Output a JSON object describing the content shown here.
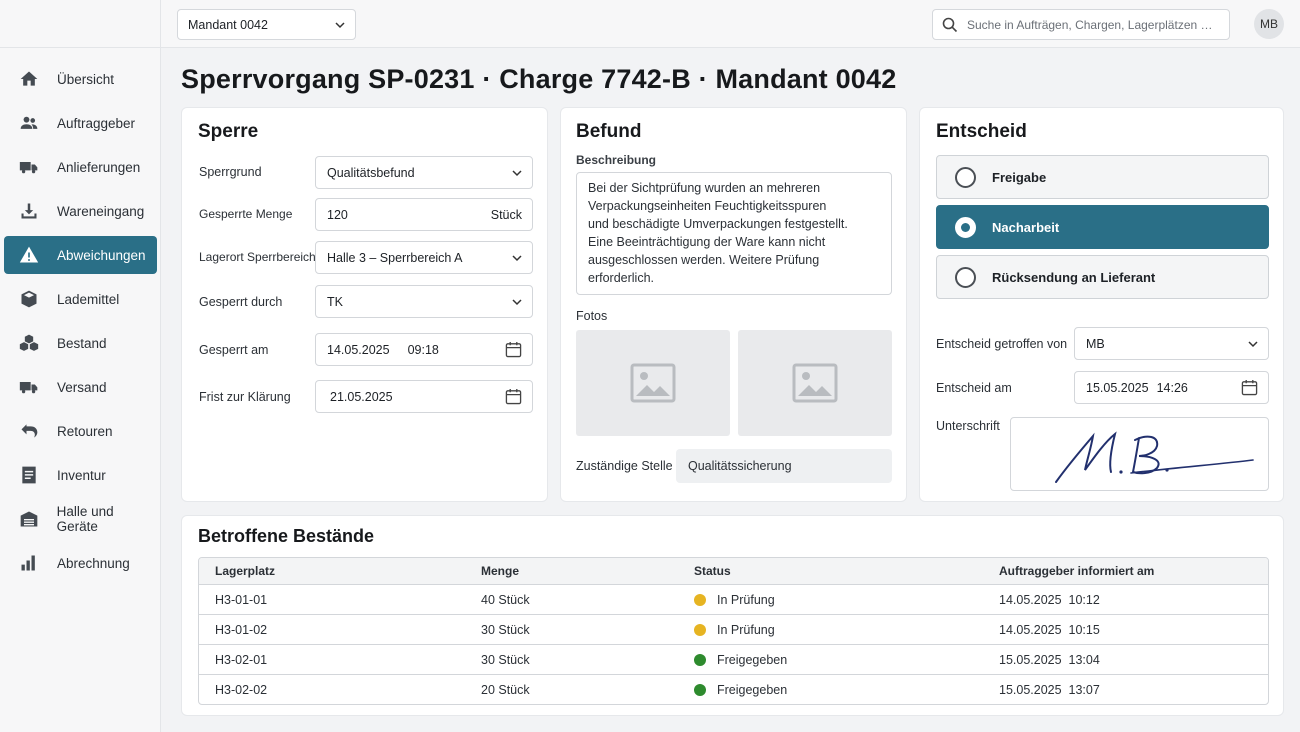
{
  "topbar": {
    "mandant_label": "Mandant 0042",
    "search_placeholder": "Suche in Aufträgen, Chargen, Lagerplätzen …",
    "avatar": "MB"
  },
  "sidebar": {
    "items": [
      {
        "label": "Übersicht",
        "icon": "home-icon"
      },
      {
        "label": "Auftraggeber",
        "icon": "users-icon"
      },
      {
        "label": "Anlieferungen",
        "icon": "truck-icon"
      },
      {
        "label": "Wareneingang",
        "icon": "download-icon"
      },
      {
        "label": "Abweichungen",
        "icon": "warning-icon"
      },
      {
        "label": "Lademittel",
        "icon": "box-icon"
      },
      {
        "label": "Bestand",
        "icon": "boxes-icon"
      },
      {
        "label": "Versand",
        "icon": "truck-icon"
      },
      {
        "label": "Retouren",
        "icon": "return-arrow-icon"
      },
      {
        "label": "Inventur",
        "icon": "document-icon"
      },
      {
        "label": "Halle und Geräte",
        "icon": "warehouse-icon"
      },
      {
        "label": "Abrechnung",
        "icon": "bar-chart-icon"
      }
    ],
    "active_index": 4
  },
  "page": {
    "title": "Sperrvorgang SP-0231 · Charge 7742-B · Mandant 0042"
  },
  "sperre": {
    "heading": "Sperre",
    "fields": {
      "sperrgrund": {
        "label": "Sperrgrund",
        "value": "Qualitätsbefund"
      },
      "menge": {
        "label": "Gesperrte Menge",
        "value": "120",
        "unit": "Stück"
      },
      "lagerort": {
        "label": "Lagerort Sperrbereich",
        "value": "Halle 3 – Sperrbereich A"
      },
      "durch": {
        "label": "Gesperrt durch",
        "value": "TK"
      },
      "am": {
        "label": "Gesperrt am",
        "date": "14.05.2025",
        "time": "09:18"
      },
      "frist": {
        "label": "Frist zur Klärung",
        "date": "21.05.2025"
      }
    }
  },
  "befund": {
    "heading": "Befund",
    "desc_label": "Beschreibung",
    "desc_lines": [
      "Bei der Sichtprüfung wurden an mehreren",
      "Verpackungseinheiten Feuchtigkeitsspuren",
      "und beschädigte Umverpackungen festgestellt.",
      "Eine Beeinträchtigung der Ware kann nicht",
      "ausgeschlossen werden. Weitere Prüfung",
      "erforderlich."
    ],
    "photos_label": "Fotos",
    "stelle_label": "Zuständige Stelle",
    "stelle_value": "Qualitätssicherung"
  },
  "entscheid": {
    "heading": "Entscheid",
    "options": [
      "Freigabe",
      "Nacharbeit",
      "Rücksendung an Lieferant"
    ],
    "selected_index": 1,
    "von_label": "Entscheid getroffen von",
    "von_value": "MB",
    "am_label": "Entscheid am",
    "am_date": "15.05.2025",
    "am_time": "14:26",
    "unterschrift_label": "Unterschrift"
  },
  "bestaende": {
    "heading": "Betroffene Bestände",
    "columns": [
      "Lagerplatz",
      "Menge",
      "Status",
      "Auftraggeber informiert am"
    ],
    "rows": [
      {
        "lagerplatz": "H3-01-01",
        "menge": "40 Stück",
        "status": "In Prüfung",
        "status_color": "#e6b422",
        "informiert": "14.05.2025  10:12"
      },
      {
        "lagerplatz": "H3-01-02",
        "menge": "30 Stück",
        "status": "In Prüfung",
        "status_color": "#e6b422",
        "informiert": "14.05.2025  10:15"
      },
      {
        "lagerplatz": "H3-02-01",
        "menge": "30 Stück",
        "status": "Freigegeben",
        "status_color": "#2e8b2e",
        "informiert": "15.05.2025  13:04"
      },
      {
        "lagerplatz": "H3-02-02",
        "menge": "20 Stück",
        "status": "Freigegeben",
        "status_color": "#2e8b2e",
        "informiert": "15.05.2025  13:07"
      }
    ]
  },
  "colors": {
    "accent": "#2a6f87",
    "warn_dot": "#e6b422",
    "ok_dot": "#2e8b2e"
  }
}
